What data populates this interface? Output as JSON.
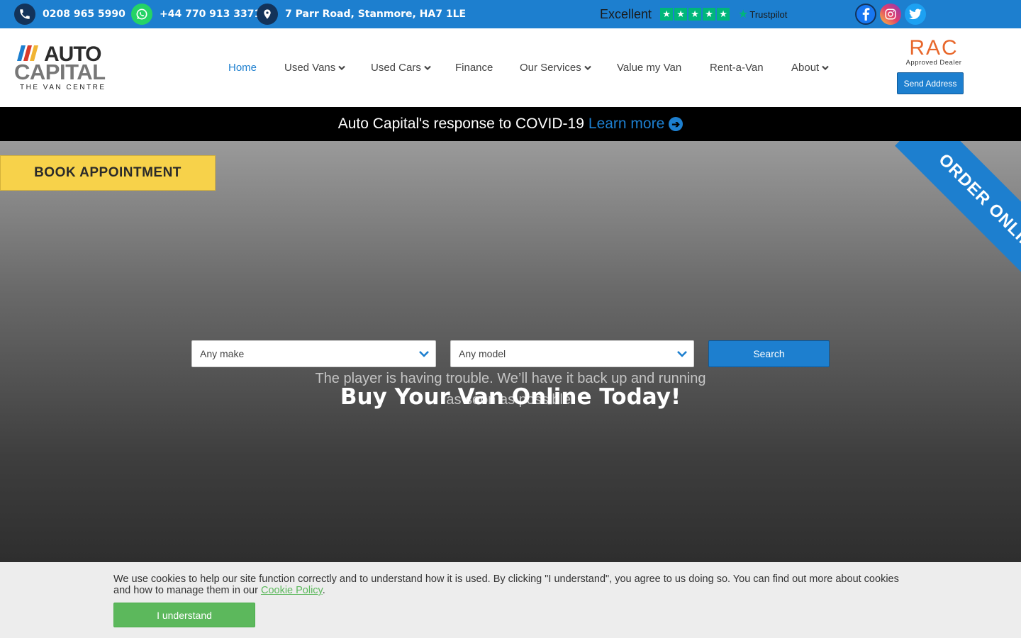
{
  "topbar": {
    "phone": "0208 965 5990",
    "whatsapp": "+44 770 913 3371",
    "address": "7 Parr Road, Stanmore, HA7 1LE",
    "trustpilot_rating": "Excellent",
    "trustpilot_brand": "Trustpilot",
    "trustpilot_stars": 5,
    "icons": [
      "phone-icon",
      "whatsapp-icon",
      "map-pin-icon",
      "facebook-icon",
      "instagram-icon",
      "twitter-icon"
    ]
  },
  "header": {
    "logo_line1": "AUTO",
    "logo_line2": "CAPITAL",
    "logo_tagline": "THE VAN CENTRE",
    "nav": [
      {
        "label": "Home",
        "dropdown": false,
        "active": true
      },
      {
        "label": "Used Vans",
        "dropdown": true
      },
      {
        "label": "Used Cars",
        "dropdown": true
      },
      {
        "label": "Finance",
        "dropdown": false
      },
      {
        "label": "Our Services",
        "dropdown": true
      },
      {
        "label": "Value my Van",
        "dropdown": false
      },
      {
        "label": "Rent-a-Van",
        "dropdown": false
      },
      {
        "label": "About",
        "dropdown": true
      }
    ],
    "rac_logo": "RAC",
    "rac_sub": "Approved Dealer",
    "send_address_label": "Send Address"
  },
  "covid": {
    "text": "Auto Capital's response to COVID-19",
    "link": "Learn more"
  },
  "hero": {
    "book_label": "BOOK APPOINTMENT",
    "ribbon_label": "ORDER ONLINE!",
    "make_select": "Any make",
    "model_select": "Any model",
    "search_label": "Search",
    "player_message": "The player is having trouble. We’ll have it back up and running as soon as possible.",
    "title": "Buy Your Van Online Today!"
  },
  "cookie": {
    "text": "We use cookies to help our site function correctly and to understand how it is used. By clicking \"I understand\", you agree to us doing so. You can find out more about cookies and how to manage them in our",
    "link": "Cookie Policy",
    "suffix": ".",
    "button": "I understand"
  },
  "colors": {
    "primary": "#1d7fcf",
    "accent_yellow": "#f7d24a",
    "cookie_green": "#5cb85c",
    "trustpilot_green": "#00b67a",
    "rac_orange": "#e8672b"
  }
}
